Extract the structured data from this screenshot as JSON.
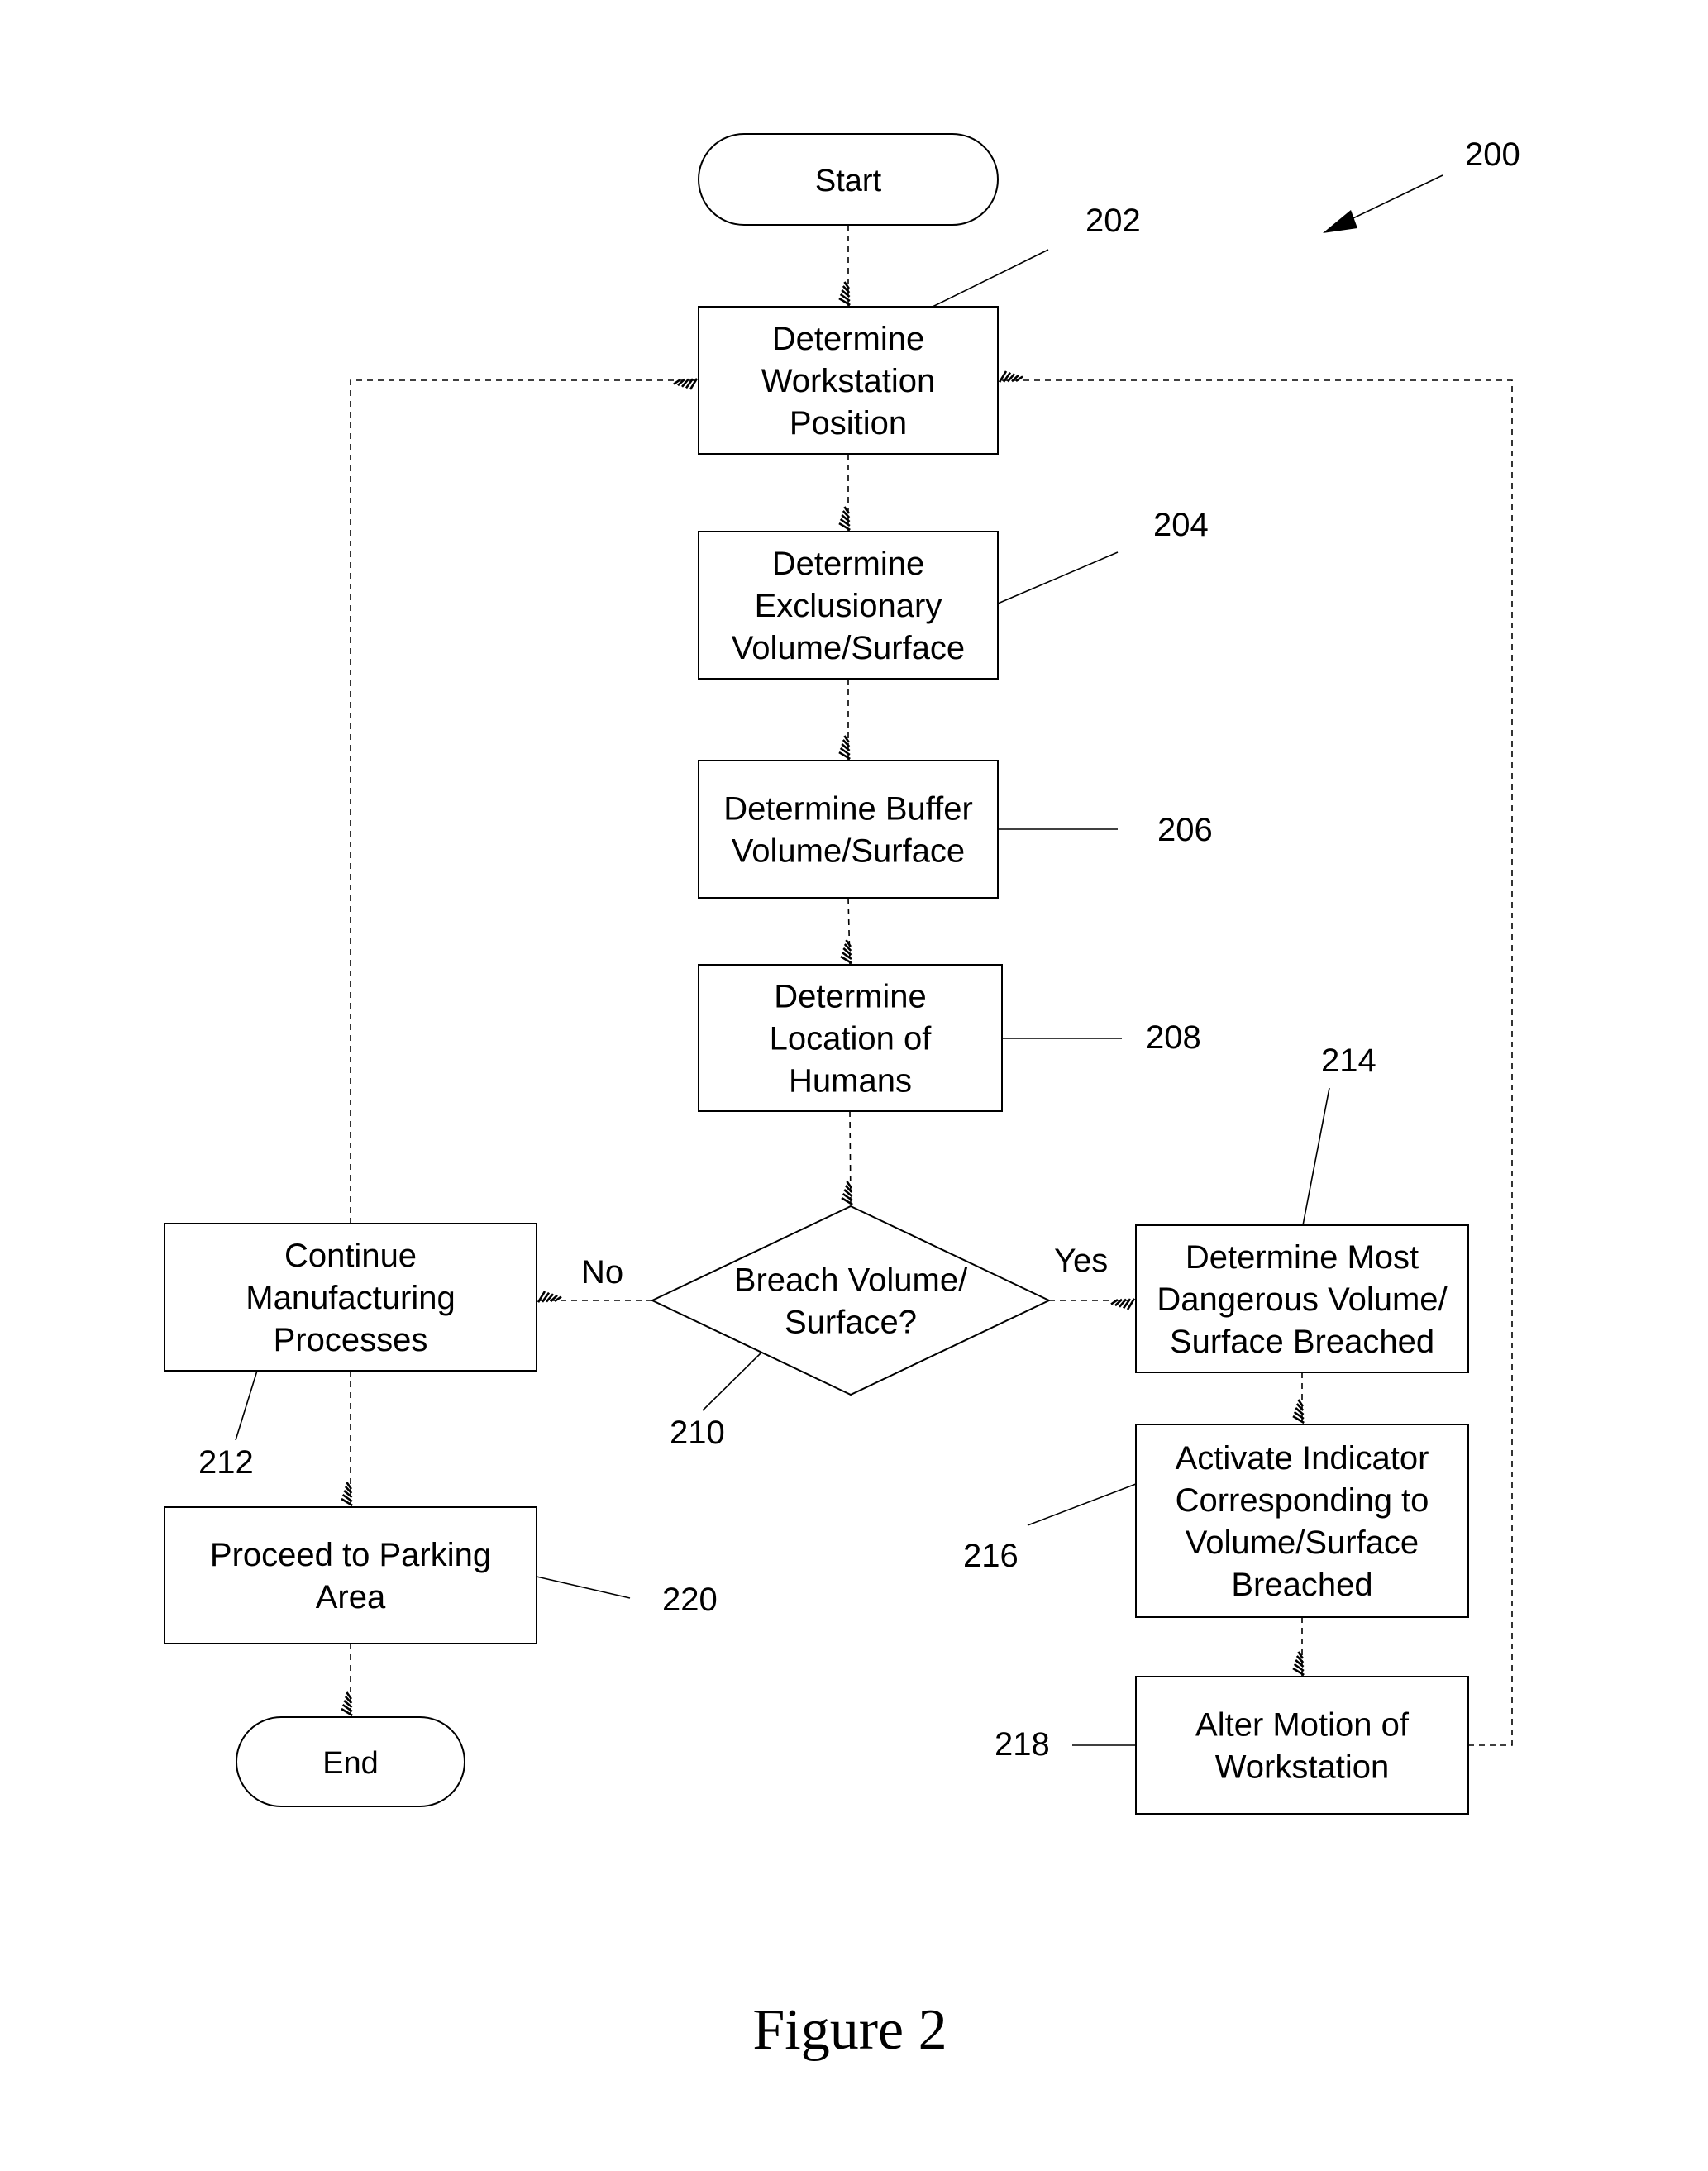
{
  "figure": {
    "caption": "Figure 2",
    "reference_number": "200"
  },
  "nodes": [
    {
      "id": "start",
      "type": "terminal",
      "lines": [
        "Start"
      ]
    },
    {
      "id": "202",
      "type": "process",
      "ref": "202",
      "lines": [
        "Determine",
        "Workstation",
        "Position"
      ]
    },
    {
      "id": "204",
      "type": "process",
      "ref": "204",
      "lines": [
        "Determine",
        "Exclusionary",
        "Volume/Surface"
      ]
    },
    {
      "id": "206",
      "type": "process",
      "ref": "206",
      "lines": [
        "Determine Buffer",
        "Volume/Surface"
      ]
    },
    {
      "id": "208",
      "type": "process",
      "ref": "208",
      "lines": [
        "Determine",
        "Location of",
        "Humans"
      ]
    },
    {
      "id": "210",
      "type": "decision",
      "ref": "210",
      "lines": [
        "Breach Volume/",
        "Surface?"
      ]
    },
    {
      "id": "212",
      "type": "process",
      "ref": "212",
      "lines": [
        "Continue",
        "Manufacturing",
        "Processes"
      ]
    },
    {
      "id": "214",
      "type": "process",
      "ref": "214",
      "lines": [
        "Determine Most",
        "Dangerous Volume/",
        "Surface Breached"
      ]
    },
    {
      "id": "216",
      "type": "process",
      "ref": "216",
      "lines": [
        "Activate Indicator",
        "Corresponding to",
        "Volume/Surface",
        "Breached"
      ]
    },
    {
      "id": "218",
      "type": "process",
      "ref": "218",
      "lines": [
        "Alter Motion of",
        "Workstation"
      ]
    },
    {
      "id": "220",
      "type": "process",
      "ref": "220",
      "lines": [
        "Proceed to Parking",
        "Area"
      ]
    },
    {
      "id": "end",
      "type": "terminal",
      "lines": [
        "End"
      ]
    }
  ],
  "edges": [
    {
      "from": "start",
      "to": "202"
    },
    {
      "from": "202",
      "to": "204"
    },
    {
      "from": "204",
      "to": "206"
    },
    {
      "from": "206",
      "to": "208"
    },
    {
      "from": "208",
      "to": "210"
    },
    {
      "from": "210",
      "to": "214",
      "label": "Yes"
    },
    {
      "from": "210",
      "to": "212",
      "label": "No"
    },
    {
      "from": "214",
      "to": "216"
    },
    {
      "from": "216",
      "to": "218"
    },
    {
      "from": "218",
      "to": "202"
    },
    {
      "from": "212",
      "to": "202"
    },
    {
      "from": "212",
      "to": "220"
    },
    {
      "from": "220",
      "to": "end"
    }
  ],
  "branch_labels": {
    "yes": "Yes",
    "no": "No"
  }
}
